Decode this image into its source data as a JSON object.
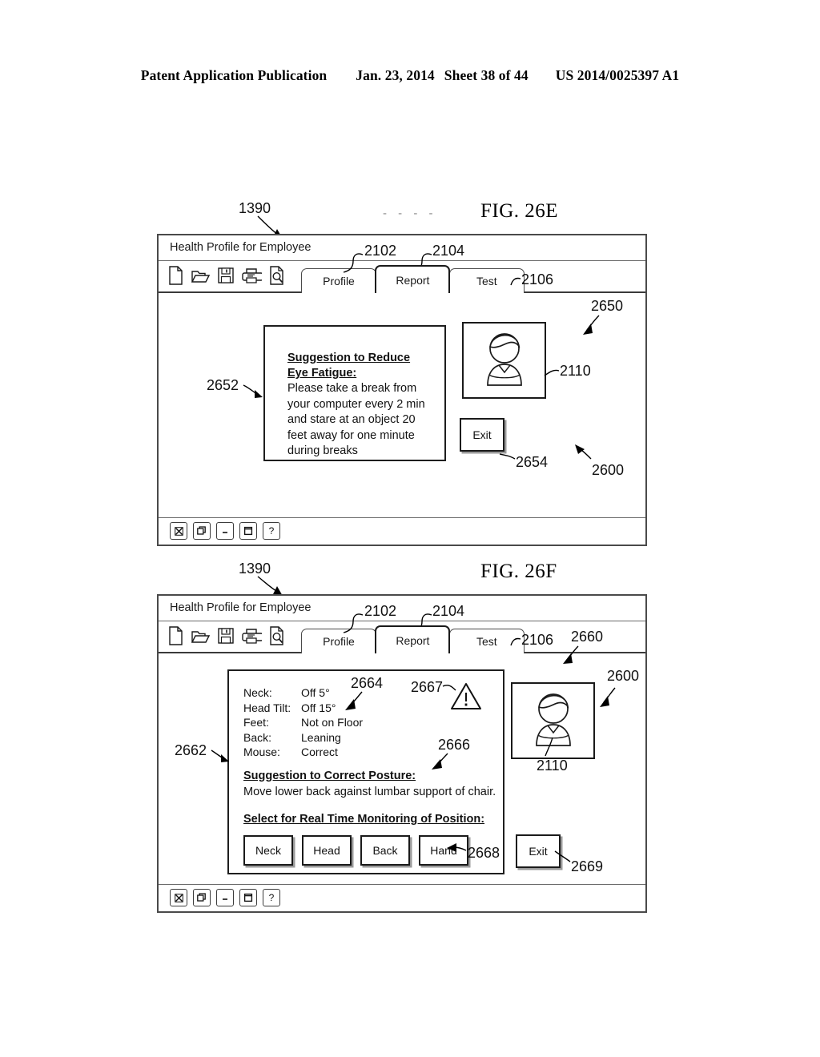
{
  "page_header": {
    "publication": "Patent Application Publication",
    "date": "Jan. 23, 2014",
    "sheet": "Sheet 38 of 44",
    "patent_number": "US 2014/0025397 A1"
  },
  "figures": [
    {
      "caption": "FIG. 26E",
      "window_ref": "1390",
      "dots": "- - - -",
      "window": {
        "title": "Health Profile for Employee",
        "toolbar_icons": [
          "new-document-icon",
          "open-folder-icon",
          "save-floppy-icon",
          "print-icon",
          "print-preview-icon"
        ],
        "tabs": [
          {
            "label": "Profile",
            "active": false
          },
          {
            "label": "Report",
            "active": true
          },
          {
            "label": "Test",
            "active": false
          }
        ],
        "status_buttons": [
          "close-icon",
          "restore-icon",
          "minimize-icon",
          "maximize-icon",
          "help-icon"
        ]
      },
      "suggestion": {
        "title": "Suggestion to Reduce Eye Fatigue:",
        "body": "Please take a break from your computer every 2 min and stare at an object 20 feet away for one minute during breaks"
      },
      "exit_label": "Exit",
      "refs": {
        "tabs_profile": "2102",
        "tabs_report": "2104",
        "tabs_test": "2106",
        "screen": "2650",
        "suggestion_box": "2652",
        "exit_button": "2654",
        "avatar": "2110",
        "system": "2600"
      }
    },
    {
      "caption": "FIG. 26F",
      "window_ref": "1390",
      "window": {
        "title": "Health Profile for Employee",
        "toolbar_icons": [
          "new-document-icon",
          "open-folder-icon",
          "save-floppy-icon",
          "print-icon",
          "print-preview-icon"
        ],
        "tabs": [
          {
            "label": "Profile",
            "active": false
          },
          {
            "label": "Report",
            "active": true
          },
          {
            "label": "Test",
            "active": false
          }
        ],
        "status_buttons": [
          "close-icon",
          "restore-icon",
          "minimize-icon",
          "maximize-icon",
          "help-icon"
        ]
      },
      "posture_rows": [
        {
          "key": "Neck:",
          "value": "Off 5°"
        },
        {
          "key": "Head Tilt:",
          "value": "Off 15°"
        },
        {
          "key": "Feet:",
          "value": "Not on Floor"
        },
        {
          "key": "Back:",
          "value": "Leaning"
        },
        {
          "key": "Mouse:",
          "value": "Correct"
        }
      ],
      "suggestion": {
        "title": "Suggestion to Correct Posture:",
        "body": "Move lower back against lumbar support of chair."
      },
      "monitoring": {
        "title": "Select for Real Time Monitoring of Position:",
        "buttons": [
          "Neck",
          "Head",
          "Back",
          "Hand"
        ]
      },
      "exit_label": "Exit",
      "warning_icon": "warning-triangle-icon",
      "refs": {
        "tabs_profile": "2102",
        "tabs_report": "2104",
        "tabs_test": "2106",
        "screen": "2660",
        "data_box": "2662",
        "posture_values": "2664",
        "suggestion": "2666",
        "warning": "2667",
        "monitor_buttons": "2668",
        "exit_button": "2669",
        "avatar": "2110",
        "system": "2600"
      }
    }
  ]
}
